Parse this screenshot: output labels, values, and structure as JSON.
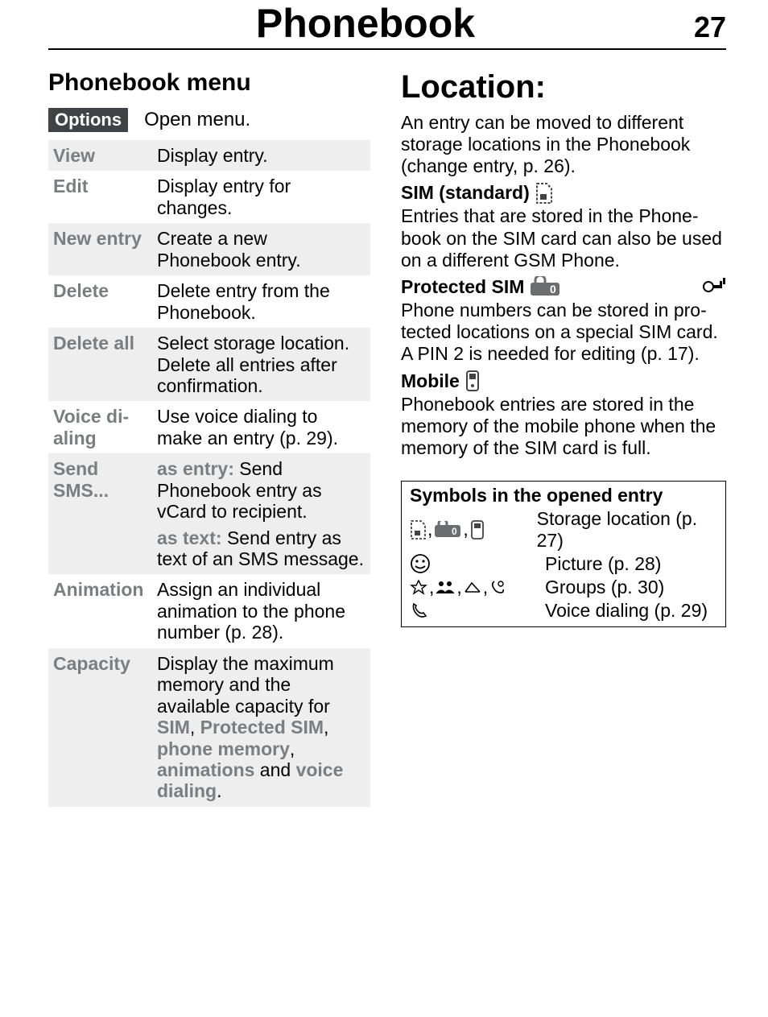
{
  "header": {
    "title": "Phonebook",
    "page_number": "27"
  },
  "left": {
    "heading": "Phonebook menu",
    "options_pill": "Options",
    "options_text": "Open menu.",
    "rows": [
      {
        "key": "View",
        "val": "Display entry."
      },
      {
        "key": "Edit",
        "val": "Display entry for changes."
      },
      {
        "key": "New entry",
        "val": "Create a new Phonebook entry."
      },
      {
        "key": "Delete",
        "val": "Delete entry from the Phone­book."
      },
      {
        "key": "Delete all",
        "val": "Select storage location. Delete all entries after confirmation."
      },
      {
        "key": "Voice di­aling",
        "val": "Use voice dialing to make an entry (p. 29)."
      },
      {
        "key": "Send SMS...",
        "parts": [
          {
            "bold": "as entry: ",
            "rest": "Send Phonebook entry as vCard to recipient."
          },
          {
            "bold": "as text: ",
            "rest": "Send entry as text of an SMS message."
          }
        ]
      },
      {
        "key": "Anima­tion",
        "val": "Assign an individual animation to the phone number (p. 28)."
      },
      {
        "key": "Capacity",
        "cap_pre": "Display the maximum memory and the available capacity for ",
        "cap_b1": "SIM",
        "cap_s1": ", ",
        "cap_b2": "Protected SIM",
        "cap_s2": ", ",
        "cap_b3": "phone memory",
        "cap_s3": ", ",
        "cap_b4": "animations",
        "cap_s4": " and ",
        "cap_b5": "voice dialing",
        "cap_s5": "."
      }
    ]
  },
  "right": {
    "heading": "Location:",
    "intro": "An entry can be moved to different storage locations in the Phonebook (change entry, p. 26).",
    "sim_std_label": "SIM (standard)",
    "sim_std_text": "Entries that are stored in the Phone­book on the SIM card can also be used on a different GSM Phone.",
    "prot_sim_label": "Protected SIM",
    "prot_sim_text": "Phone numbers can be stored in pro­tected locations on a special SIM card. A PIN 2 is needed for editing (p. 17).",
    "mobile_label": "Mobile",
    "mobile_text": "Phonebook entries are stored in the memory of the mobile phone when the memory of the SIM card is full.",
    "symbox": {
      "title": "Symbols in the opened entry",
      "rows": [
        {
          "icons": "storage-icons",
          "text": "Storage location (p. 27)"
        },
        {
          "icons": "smile-icon",
          "text": "Picture (p. 28)"
        },
        {
          "icons": "groups-icons",
          "text": "Groups (p. 30)"
        },
        {
          "icons": "voice-icon",
          "text": "Voice dialing (p. 29)"
        }
      ]
    }
  }
}
